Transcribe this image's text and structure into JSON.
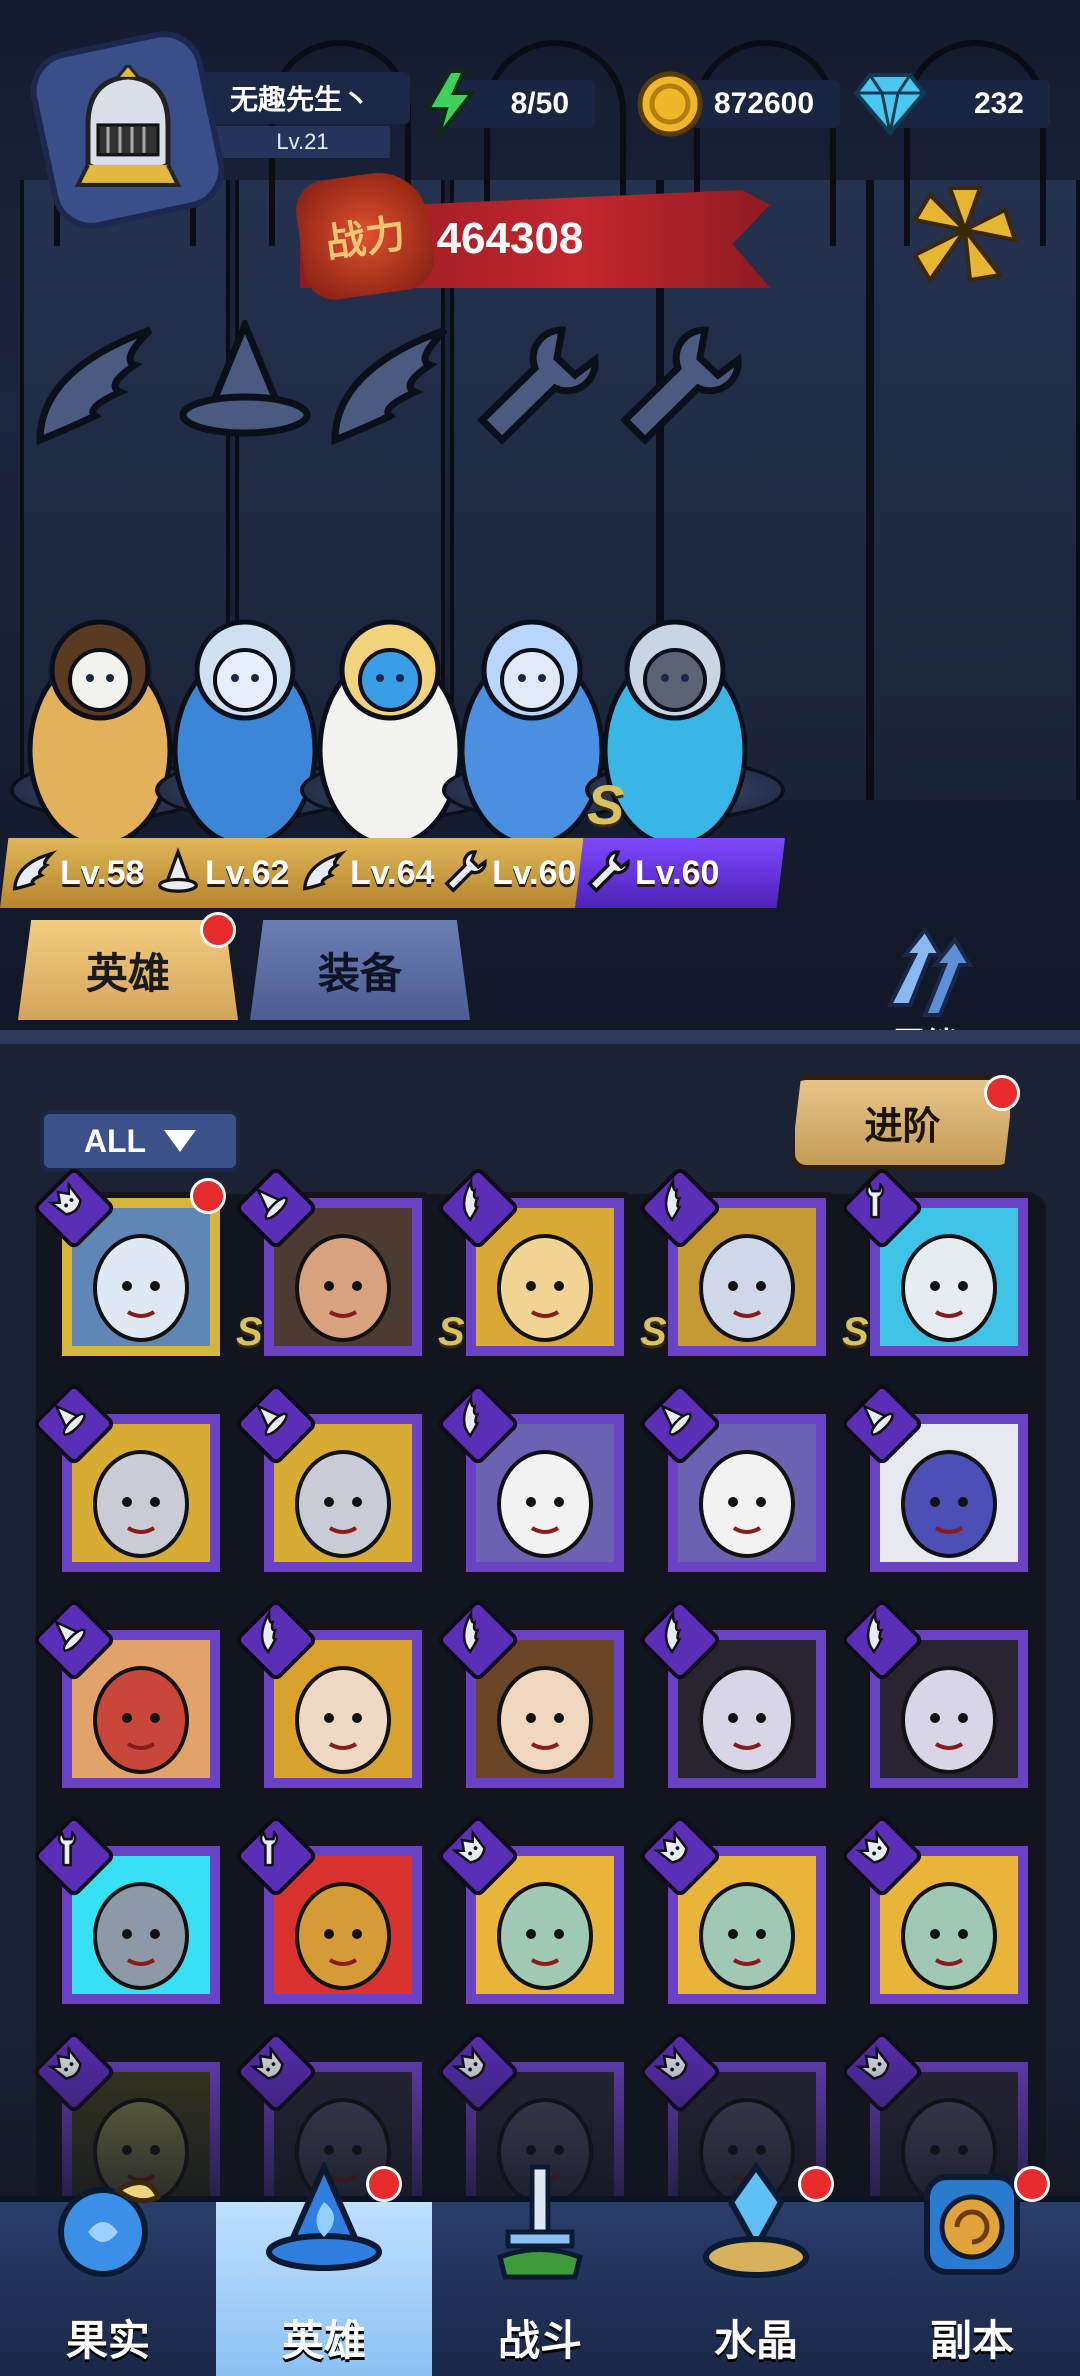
{
  "player": {
    "name": "无趣先生丶",
    "level": "Lv.21"
  },
  "resources": {
    "energy": "8/50",
    "gold": "872600",
    "diamonds": "232"
  },
  "power": {
    "label": "战力",
    "value": "464308"
  },
  "heroes": [
    {
      "level": "Lv.58",
      "class_icon": "wing-icon",
      "tag_color": "#d4a94f"
    },
    {
      "level": "Lv.62",
      "class_icon": "hat-icon",
      "tag_color": "#d4a94f"
    },
    {
      "level": "Lv.64",
      "class_icon": "wing-icon",
      "tag_color": "#d4a94f"
    },
    {
      "level": "Lv.60",
      "class_icon": "wrench-icon",
      "tag_color": "#d4a94f"
    },
    {
      "level": "Lv.60",
      "class_icon": "wrench-icon",
      "tag_color": "#6a35e8",
      "rank": "S"
    }
  ],
  "tabs": {
    "heroes": "英雄",
    "equipment": "装备"
  },
  "bond": {
    "label": "羁绊"
  },
  "filter": {
    "label": "ALL"
  },
  "advance": {
    "label": "进阶"
  },
  "roster": [
    [
      {
        "face": "white-beast",
        "class": "beast-icon",
        "rank": "",
        "frame": "gold",
        "badge": true
      },
      {
        "face": "bald-warrior",
        "class": "hat-icon",
        "rank": "S"
      },
      {
        "face": "golden-sage",
        "class": "wing-icon",
        "rank": "S"
      },
      {
        "face": "armored-knight",
        "class": "wing-icon",
        "rank": "S"
      },
      {
        "face": "white-robot",
        "class": "wrench-icon",
        "rank": "S"
      }
    ],
    [
      {
        "face": "helmet-knight",
        "class": "hat-icon"
      },
      {
        "face": "helmet-knight",
        "class": "hat-icon"
      },
      {
        "face": "veiled-nun",
        "class": "wing-icon"
      },
      {
        "face": "veiled-nun",
        "class": "hat-icon"
      },
      {
        "face": "mage-hat",
        "class": "hat-icon"
      }
    ],
    [
      {
        "face": "hooded-mage",
        "class": "hat-icon"
      },
      {
        "face": "pharaoh",
        "class": "wing-icon"
      },
      {
        "face": "laurel-goddess",
        "class": "wing-icon"
      },
      {
        "face": "dark-lady",
        "class": "wing-icon"
      },
      {
        "face": "dark-lady",
        "class": "wing-icon"
      }
    ],
    [
      {
        "face": "robot-cube",
        "class": "wrench-icon"
      },
      {
        "face": "robot-gold",
        "class": "wrench-icon"
      },
      {
        "face": "elf-queen",
        "class": "beast-icon"
      },
      {
        "face": "elf-queen",
        "class": "beast-icon"
      },
      {
        "face": "elf-queen",
        "class": "beast-icon"
      }
    ],
    [
      {
        "face": "goblin",
        "class": "beast-icon"
      },
      {
        "face": "shadow",
        "class": "beast-icon"
      },
      {
        "face": "shadow",
        "class": "beast-icon"
      },
      {
        "face": "shadow",
        "class": "beast-icon"
      },
      {
        "face": "shadow",
        "class": "beast-icon"
      }
    ]
  ],
  "nav": [
    {
      "label": "果实",
      "icon": "fruit-icon",
      "badge": false
    },
    {
      "label": "英雄",
      "icon": "hero-hat-icon",
      "badge": true,
      "active": true
    },
    {
      "label": "战斗",
      "icon": "sword-icon",
      "badge": false
    },
    {
      "label": "水晶",
      "icon": "crystal-icon",
      "badge": true
    },
    {
      "label": "副本",
      "icon": "dungeon-icon",
      "badge": true
    }
  ]
}
